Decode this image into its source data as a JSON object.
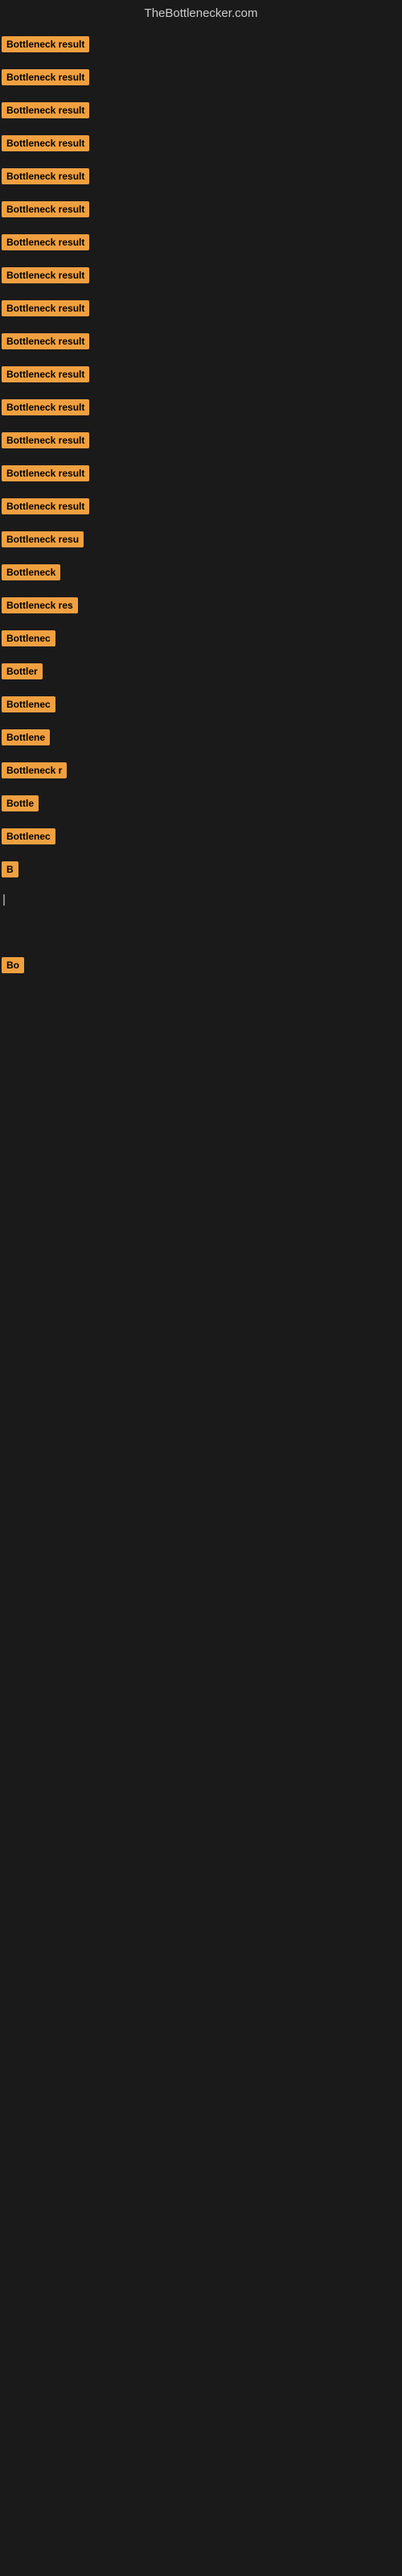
{
  "header": {
    "title": "TheBottlenecker.com"
  },
  "items": [
    {
      "label": "Bottleneck result",
      "width": 150
    },
    {
      "label": "Bottleneck result",
      "width": 150
    },
    {
      "label": "Bottleneck result",
      "width": 150
    },
    {
      "label": "Bottleneck result",
      "width": 150
    },
    {
      "label": "Bottleneck result",
      "width": 150
    },
    {
      "label": "Bottleneck result",
      "width": 150
    },
    {
      "label": "Bottleneck result",
      "width": 150
    },
    {
      "label": "Bottleneck result",
      "width": 150
    },
    {
      "label": "Bottleneck result",
      "width": 150
    },
    {
      "label": "Bottleneck result",
      "width": 150
    },
    {
      "label": "Bottleneck result",
      "width": 150
    },
    {
      "label": "Bottleneck result",
      "width": 150
    },
    {
      "label": "Bottleneck result",
      "width": 150
    },
    {
      "label": "Bottleneck result",
      "width": 150
    },
    {
      "label": "Bottleneck result",
      "width": 150
    },
    {
      "label": "Bottleneck resu",
      "width": 130
    },
    {
      "label": "Bottleneck",
      "width": 90
    },
    {
      "label": "Bottleneck res",
      "width": 115
    },
    {
      "label": "Bottlenec",
      "width": 85
    },
    {
      "label": "Bottler",
      "width": 65
    },
    {
      "label": "Bottlenec",
      "width": 85
    },
    {
      "label": "Bottlene",
      "width": 78
    },
    {
      "label": "Bottleneck r",
      "width": 100
    },
    {
      "label": "Bottle",
      "width": 60
    },
    {
      "label": "Bottlenec",
      "width": 85
    },
    {
      "label": "B",
      "width": 18
    },
    {
      "label": "|",
      "width": 8
    },
    {
      "label": "",
      "width": 0
    },
    {
      "label": "",
      "width": 0
    },
    {
      "label": "",
      "width": 0
    },
    {
      "label": "Bo",
      "width": 25
    },
    {
      "label": "",
      "width": 0
    },
    {
      "label": "",
      "width": 0
    },
    {
      "label": "",
      "width": 0
    },
    {
      "label": "",
      "width": 0
    }
  ]
}
